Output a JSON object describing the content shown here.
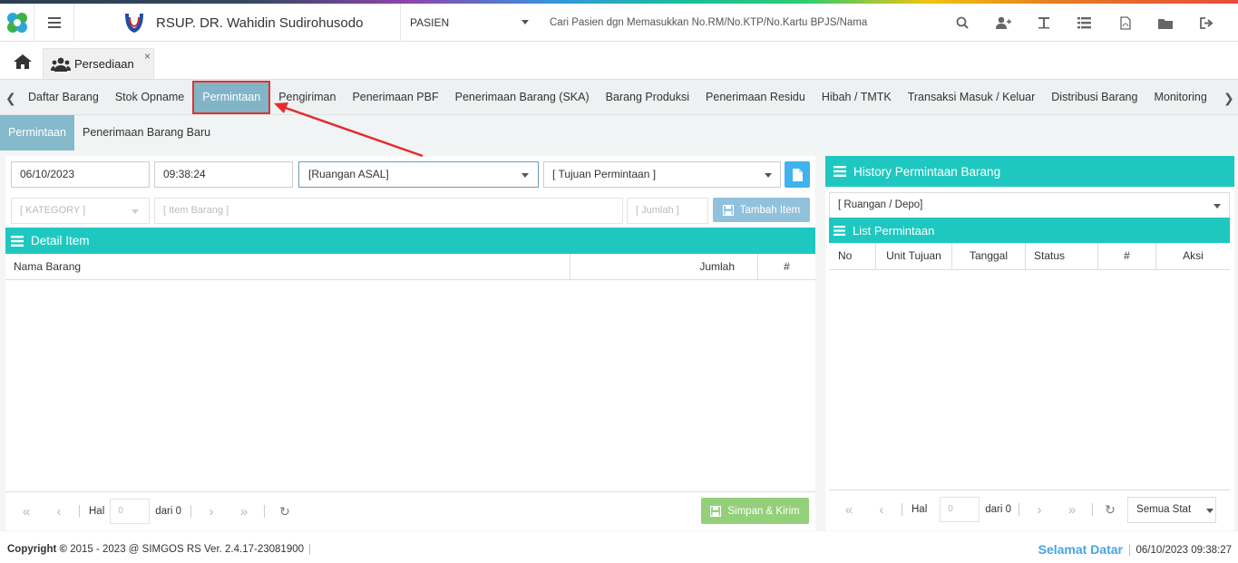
{
  "header": {
    "hospital_name": "RSUP. DR. Wahidin Sudirohusodo",
    "patient_type": "PASIEN",
    "search_placeholder": "Cari Pasien dgn Memasukkan No.RM/No.KTP/No.Kartu BPJS/Nama",
    "icons": [
      "search-icon",
      "add-user-icon",
      "text-icon",
      "list-icon",
      "pdf-icon",
      "folder-icon",
      "logout-icon"
    ]
  },
  "tabs": {
    "open_tab": "Persediaan",
    "close": "×"
  },
  "menu": {
    "items": [
      "Daftar Barang",
      "Stok Opname",
      "Permintaan",
      "Pengiriman",
      "Penerimaan PBF",
      "Penerimaan Barang (SKA)",
      "Barang Produksi",
      "Penerimaan Residu",
      "Hibah / TMTK",
      "Transaksi Masuk / Keluar",
      "Distribusi Barang",
      "Monitoring",
      "Moni"
    ],
    "active": "Permintaan"
  },
  "subtabs": {
    "items": [
      "Permintaan",
      "Penerimaan Barang Baru"
    ],
    "active": "Permintaan"
  },
  "form": {
    "date": "06/10/2023",
    "time": "09:38:24",
    "ruangan_asal": "[Ruangan ASAL]",
    "tujuan": "[ Tujuan Permintaan ]",
    "category_placeholder": "[ KATEGORY ]",
    "item_placeholder": "[ Item Barang ]",
    "jumlah_placeholder": "[ Jumlah ]",
    "tambah_label": "Tambah Item"
  },
  "detail": {
    "title": "Detail Item",
    "columns": [
      "Nama Barang",
      "Jumlah",
      "#"
    ],
    "pager": {
      "hal": "Hal",
      "page": "0",
      "dari": "dari 0"
    },
    "simpan_label": "Simpan & Kirim"
  },
  "history": {
    "title": "History Permintaan Barang",
    "ruangan_placeholder": "[ Ruangan / Depo]",
    "list_title": "List Permintaan",
    "columns": [
      "No",
      "Unit Tujuan",
      "Tanggal",
      "Status",
      "#",
      "Aksi"
    ],
    "pager": {
      "hal": "Hal",
      "page": "0",
      "dari": "dari 0"
    },
    "status_filter": "Semua Stat"
  },
  "footer": {
    "copyright": "Copyright",
    "copy_rest": "2015 - 2023 @ SIMGOS RS Ver. 2.4.17-23081900",
    "welcome": "Selamat Datar",
    "datetime": "06/10/2023 09:38:27"
  },
  "colors": {
    "teal": "#1ec8c0",
    "active_tab": "#80b4c6",
    "highlight": "#e23232",
    "save": "#94d07a"
  }
}
